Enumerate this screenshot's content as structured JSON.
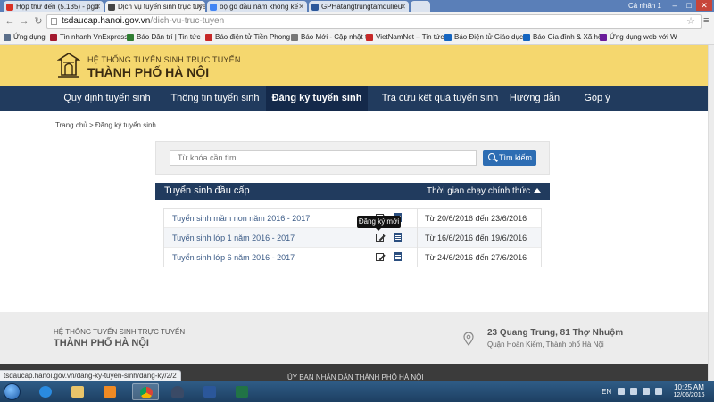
{
  "browser": {
    "tabs": [
      {
        "title": "Hộp thư đến (5.135) - pgd",
        "favicon_color": "#d93025"
      },
      {
        "title": "Dịch vụ tuyển sinh trực tuyế",
        "favicon_color": "#444444"
      },
      {
        "title": "bộ gd đầu năm không kế",
        "favicon_color": "#4285f4"
      },
      {
        "title": "GPHatangtrungtamdulieu",
        "favicon_color": "#2b579a"
      }
    ],
    "profile_label": "Cá nhân 1",
    "window_buttons": [
      "–",
      "□",
      "✕"
    ],
    "url_host": "tsdaucap.hanoi.gov.vn",
    "url_path": "/dich-vu-truc-tuyen",
    "bookmarks": [
      {
        "label": "Ứng dụng",
        "color": "#5b6f8a"
      },
      {
        "label": "Tin nhanh VnExpress",
        "color": "#a3192f"
      },
      {
        "label": "Báo Dân trí | Tin tức",
        "color": "#2f7d32"
      },
      {
        "label": "Báo điện tử Tiền Phong",
        "color": "#c62828"
      },
      {
        "label": "Báo Mới - Cập nhật tin",
        "color": "#777777"
      },
      {
        "label": "VietNamNet – Tin tức",
        "color": "#c62828"
      },
      {
        "label": "Báo Điện tử Giáo dục",
        "color": "#1565c0"
      },
      {
        "label": "Báo Gia đình & Xã hội",
        "color": "#1565c0"
      },
      {
        "label": "Ứng dụng web với W",
        "color": "#6a1b9a"
      }
    ],
    "status_url": "tsdaucap.hanoi.gov.vn/dang-ky-tuyen-sinh/dang-ky/2/2"
  },
  "site": {
    "brand_top": "HỆ THỐNG TUYỂN SINH TRỰC TUYẾN",
    "brand_main": "THÀNH PHỐ HÀ NỘI",
    "nav": [
      {
        "label": "Quy định tuyển sinh",
        "active": false
      },
      {
        "label": "Thông tin tuyển sinh",
        "active": false
      },
      {
        "label": "Đăng ký tuyển sinh",
        "active": true
      },
      {
        "label": "Tra cứu kết quả tuyển sinh",
        "active": false
      },
      {
        "label": "Hướng dẫn",
        "active": false
      },
      {
        "label": "Góp ý",
        "active": false
      }
    ],
    "breadcrumb": "Trang chủ > Đăng ký tuyển sinh",
    "search": {
      "placeholder": "Từ khóa cần tìm...",
      "button_label": "Tìm kiếm"
    },
    "table": {
      "header_left": "Tuyển sinh đầu cấp",
      "header_right": "Thời gian chạy chính thức",
      "rows": [
        {
          "name": "Tuyển sinh mầm non năm 2016 - 2017",
          "period": "Từ 20/6/2016 đến 23/6/2016"
        },
        {
          "name": "Tuyển sinh lớp 1 năm 2016 - 2017",
          "period": "Từ 16/6/2016 đến 19/6/2016"
        },
        {
          "name": "Tuyển sinh lớp 6 năm 2016 - 2017",
          "period": "Từ 24/6/2016 đến 27/6/2016"
        }
      ],
      "tooltip": "Đăng ký mới"
    },
    "footer": {
      "top": "HỆ THỐNG TUYỂN SINH TRỰC TUYẾN",
      "main": "THÀNH PHỐ HÀ NỘI",
      "address_line1": "23 Quang Trung, 81 Thợ Nhuộm",
      "address_line2": "Quận Hoàn Kiếm, Thành phố Hà Nội",
      "bottom": "ỦY BAN NHÂN DÂN THÀNH PHỐ HÀ NỘI"
    },
    "colors": {
      "header_yellow": "#f5d76e",
      "nav_navy": "#213b5e",
      "search_blue": "#2d6db3"
    }
  },
  "taskbar": {
    "apps": [
      "internet-explorer",
      "file-explorer",
      "media-player",
      "chrome",
      "user-app",
      "word",
      "excel"
    ],
    "language": "EN",
    "time": "10:25 AM",
    "date": "12/06/2016"
  }
}
